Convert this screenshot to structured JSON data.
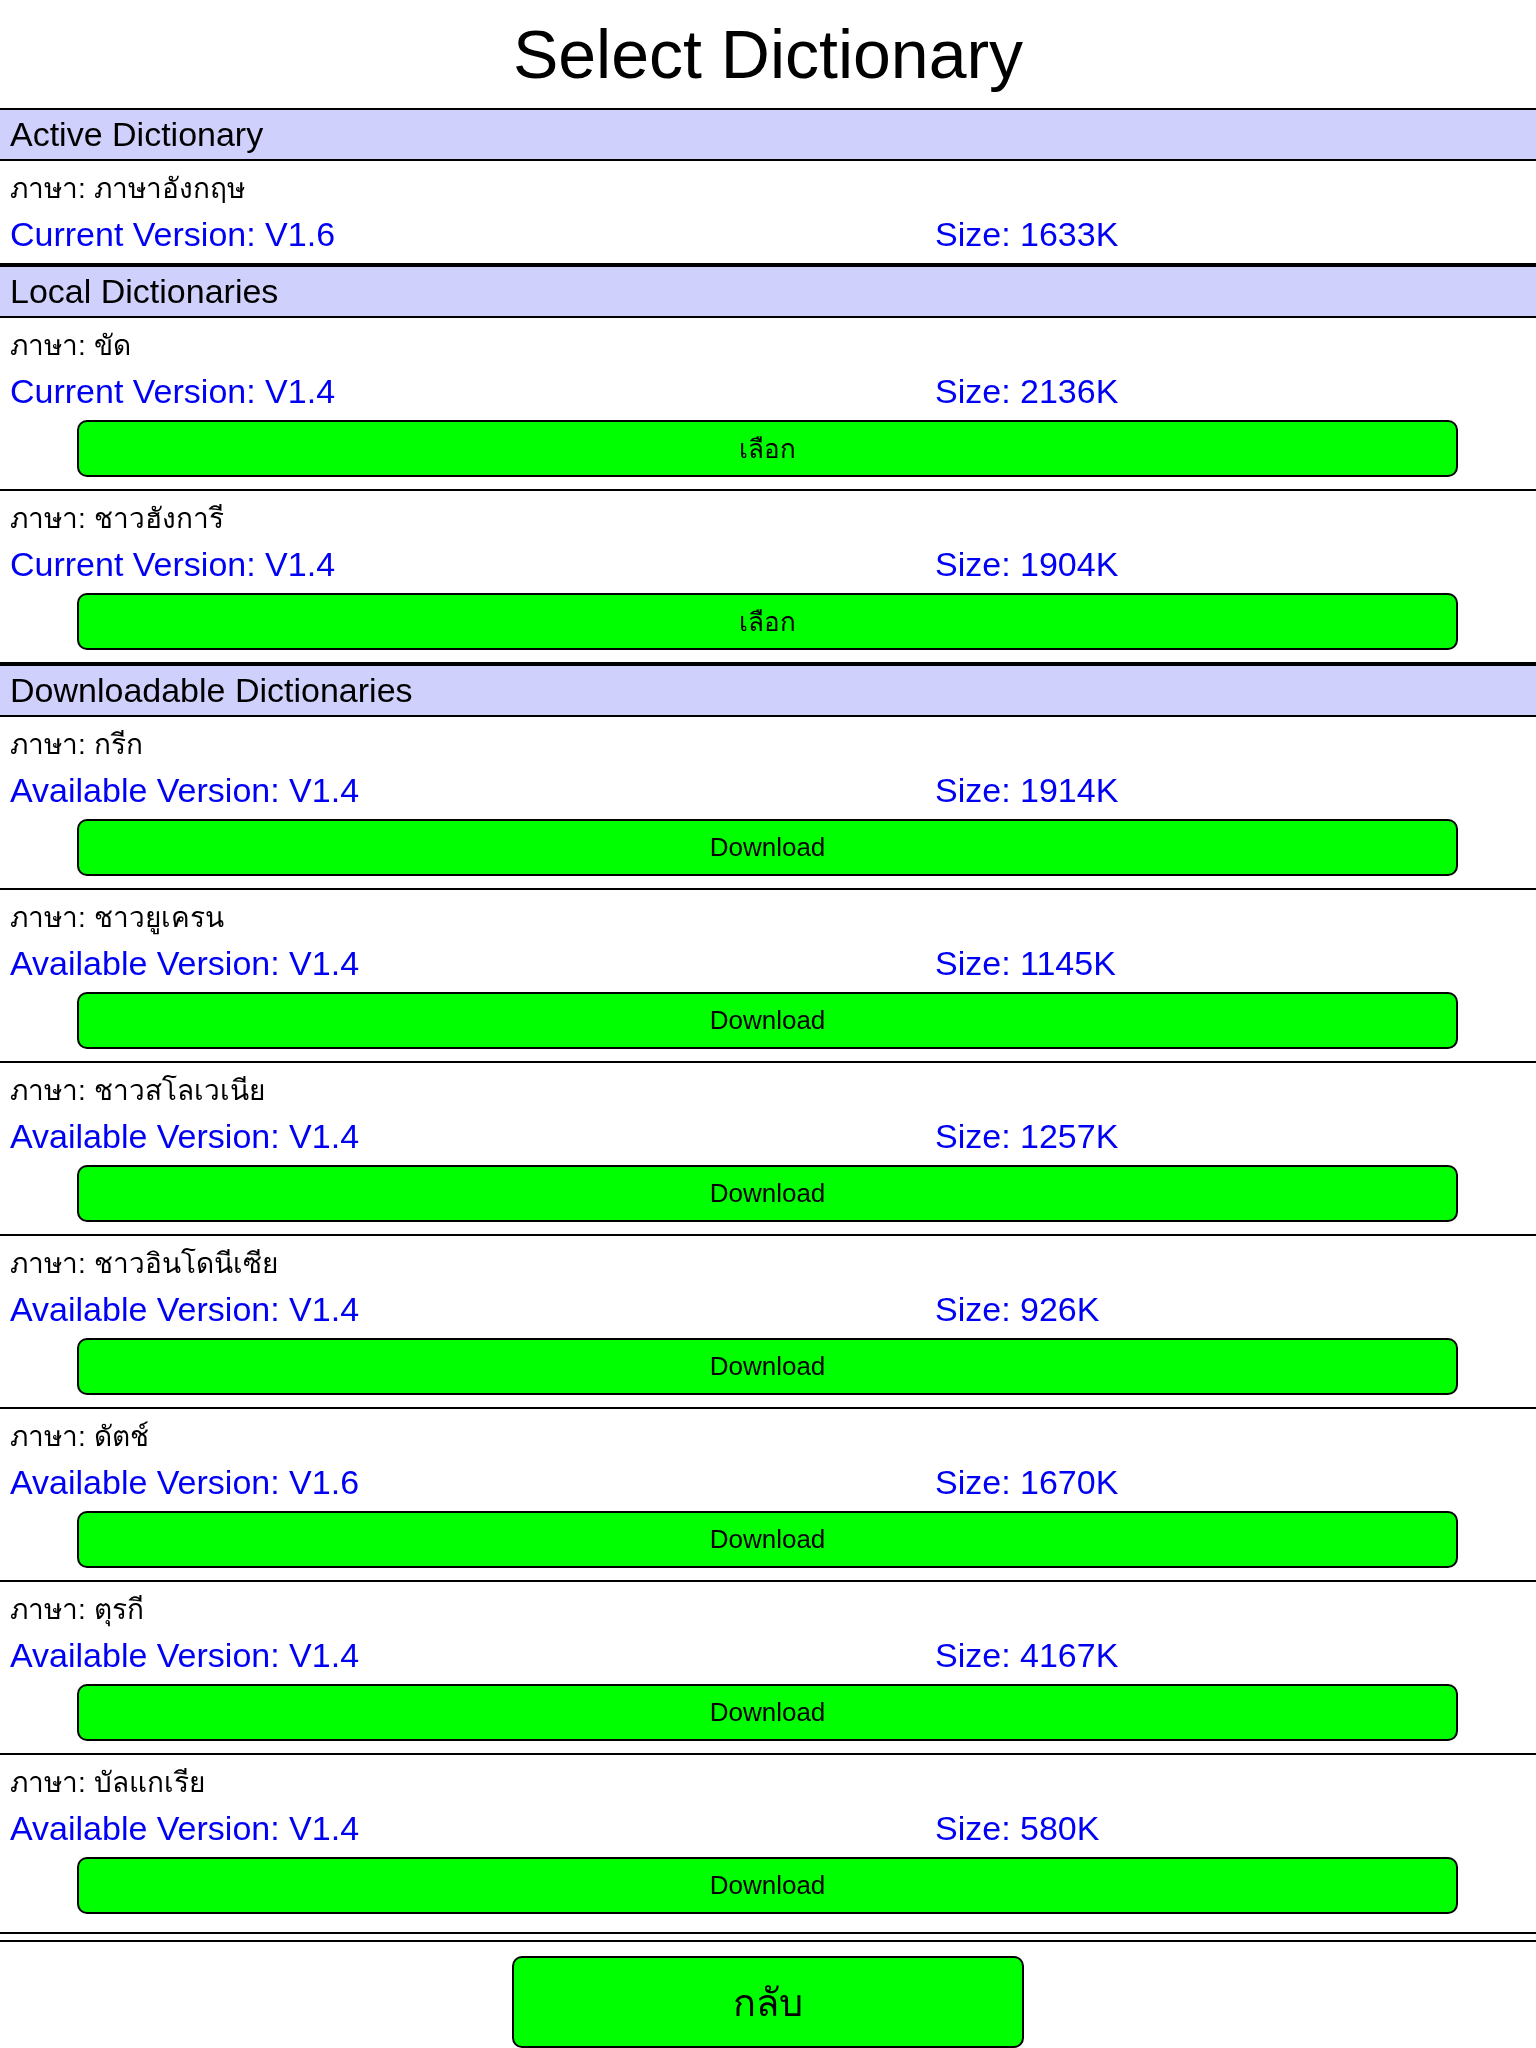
{
  "title": "Select Dictionary",
  "sections": [
    {
      "heading": "Active Dictionary",
      "entries": [
        {
          "language": "ภาษา: ภาษาอังกฤษ",
          "version": "Current Version: V1.6",
          "size": "Size: 1633K"
        }
      ]
    },
    {
      "heading": "Local Dictionaries",
      "entries": [
        {
          "language": "ภาษา: ขัด",
          "version": "Current Version: V1.4",
          "size": "Size: 2136K",
          "button": "เลือก"
        },
        {
          "language": "ภาษา: ชาวฮังการี",
          "version": "Current Version: V1.4",
          "size": "Size: 1904K",
          "button": "เลือก"
        }
      ]
    },
    {
      "heading": "Downloadable Dictionaries",
      "entries": [
        {
          "language": "ภาษา: กรีก",
          "version": "Available Version: V1.4",
          "size": "Size: 1914K",
          "button": "Download"
        },
        {
          "language": "ภาษา: ชาวยูเครน",
          "version": "Available Version: V1.4",
          "size": "Size: 1145K",
          "button": "Download"
        },
        {
          "language": "ภาษา: ชาวสโลเวเนีย",
          "version": "Available Version: V1.4",
          "size": "Size: 1257K",
          "button": "Download"
        },
        {
          "language": "ภาษา: ชาวอินโดนีเซีย",
          "version": "Available Version: V1.4",
          "size": "Size: 926K",
          "button": "Download"
        },
        {
          "language": "ภาษา: ดัตช์",
          "version": "Available Version: V1.6",
          "size": "Size: 1670K",
          "button": "Download"
        },
        {
          "language": "ภาษา: ตุรกี",
          "version": "Available Version: V1.4",
          "size": "Size: 4167K",
          "button": "Download"
        },
        {
          "language": "ภาษา: บัลแกเรีย",
          "version": "Available Version: V1.4",
          "size": "Size: 580K",
          "button": "Download"
        }
      ]
    }
  ],
  "back_button": "กลับ"
}
